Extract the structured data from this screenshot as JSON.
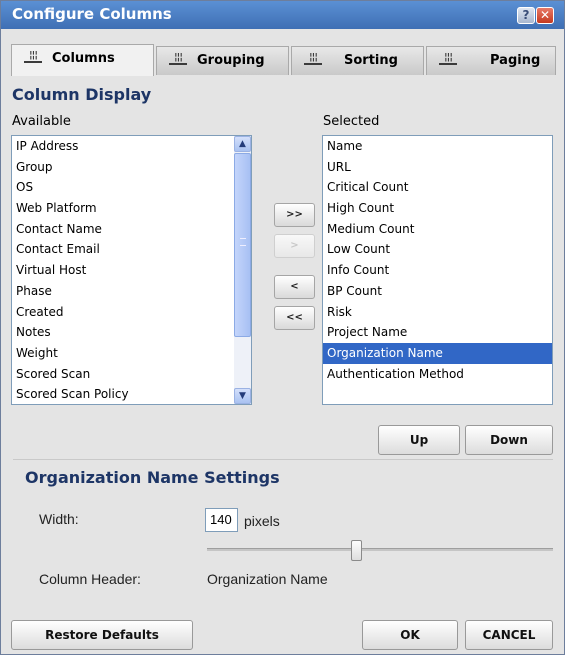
{
  "window": {
    "title": "Configure Columns",
    "help_label": "?",
    "close_label": "✕"
  },
  "tabs": [
    {
      "label": "Columns",
      "active": true,
      "icon": "columns-icon"
    },
    {
      "label": "Grouping",
      "active": false,
      "icon": "columns-icon"
    },
    {
      "label": "Sorting",
      "active": false,
      "icon": "columns-icon"
    },
    {
      "label": "Paging",
      "active": false,
      "icon": "columns-icon"
    }
  ],
  "column_display": {
    "title": "Column Display",
    "available_label": "Available",
    "selected_label": "Selected",
    "available_items": [
      "IP Address",
      "Group",
      "OS",
      "Web Platform",
      "Contact Name",
      "Contact Email",
      "Virtual Host",
      "Phase",
      "Created",
      "Notes",
      "Weight",
      "Scored Scan",
      "Scored Scan Policy"
    ],
    "selected_items": [
      "Name",
      "URL",
      "Critical Count",
      "High Count",
      "Medium Count",
      "Low Count",
      "Info Count",
      "BP Count",
      "Risk",
      "Project Name",
      "Organization Name",
      "Authentication Method"
    ],
    "selected_highlight": "Organization Name",
    "buttons": {
      "add_all": ">>",
      "add": ">",
      "remove": "<",
      "remove_all": "<<",
      "up": "Up",
      "down": "Down"
    }
  },
  "settings": {
    "title": "Organization Name Settings",
    "width_label": "Width:",
    "width_value": "140",
    "width_unit": "pixels",
    "slider_fraction": 0.43,
    "header_label": "Column Header:",
    "header_value": "Organization Name"
  },
  "footer": {
    "restore_label": "Restore Defaults",
    "ok_label": "OK",
    "cancel_label": "CANCEL"
  },
  "colors": {
    "title_bar": "#4a7cc4",
    "section_title": "#1d3566",
    "selection": "#3167c6"
  }
}
